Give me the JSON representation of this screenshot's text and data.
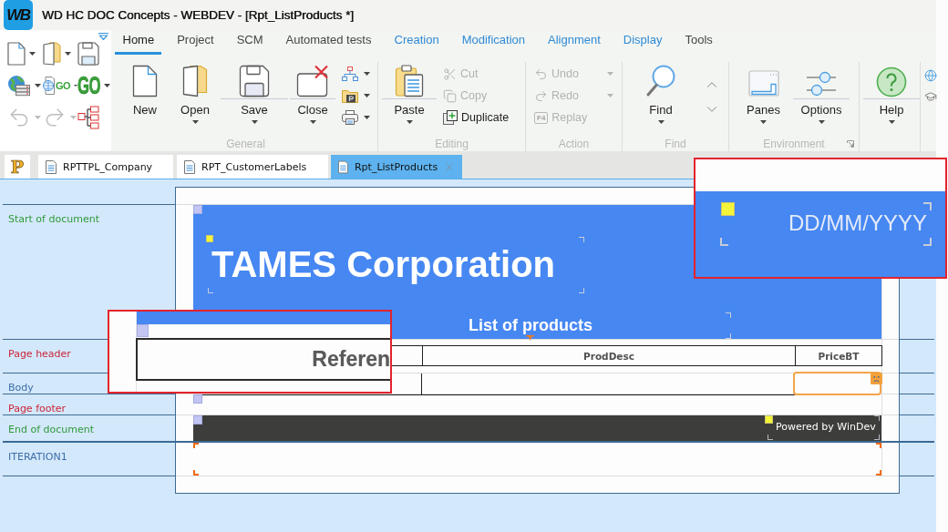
{
  "window": {
    "logo": "WB",
    "title": "WD HC DOC Concepts - WEBDEV - [Rpt_ListProducts *]"
  },
  "quick_access": {
    "go_buttons": [
      {
        "kind": "site",
        "label": "GO"
      },
      {
        "kind": "plain",
        "label": "GO"
      }
    ]
  },
  "ribbon_tabs": [
    {
      "label": "Home",
      "selected": true,
      "kind": "main"
    },
    {
      "label": "Project",
      "selected": false,
      "kind": "main"
    },
    {
      "label": "SCM",
      "selected": false,
      "kind": "main"
    },
    {
      "label": "Automated tests",
      "selected": false,
      "kind": "main"
    },
    {
      "label": "Creation",
      "selected": false,
      "kind": "context"
    },
    {
      "label": "Modification",
      "selected": false,
      "kind": "context"
    },
    {
      "label": "Alignment",
      "selected": false,
      "kind": "context"
    },
    {
      "label": "Display",
      "selected": false,
      "kind": "context"
    },
    {
      "label": "Tools",
      "selected": false,
      "kind": "main"
    }
  ],
  "ribbon_groups": [
    {
      "title": "General",
      "buttons": [
        {
          "kind": "large",
          "label": "New",
          "dropdown": false,
          "split": false
        },
        {
          "kind": "large",
          "label": "Open",
          "dropdown": true,
          "split": false
        },
        {
          "kind": "large",
          "label": "Save",
          "dropdown": true,
          "split": true
        },
        {
          "kind": "large",
          "label": "Close",
          "dropdown": true,
          "split": true
        },
        {
          "kind": "icon_stack"
        }
      ]
    },
    {
      "title": "Editing",
      "buttons": [
        {
          "kind": "large",
          "label": "Paste",
          "dropdown": true,
          "split": true
        },
        {
          "kind": "small_stack",
          "items": [
            {
              "label": "Cut",
              "disabled": true,
              "dropdown": false
            },
            {
              "label": "Copy",
              "disabled": true,
              "dropdown": false
            },
            {
              "label": "Duplicate",
              "disabled": false,
              "dropdown": false
            }
          ]
        }
      ]
    },
    {
      "title": "Action",
      "buttons": [
        {
          "kind": "small_stack",
          "items": [
            {
              "label": "Undo",
              "disabled": true,
              "dropdown": true
            },
            {
              "label": "Redo",
              "disabled": true,
              "dropdown": true
            },
            {
              "label": "Replay",
              "disabled": true,
              "dropdown": false,
              "shortcut": "F4"
            }
          ]
        }
      ]
    },
    {
      "title": "Find",
      "buttons": [
        {
          "kind": "large",
          "label": "Find",
          "dropdown": true,
          "split": false
        },
        {
          "kind": "nav_arrows"
        }
      ]
    },
    {
      "title": "Environment",
      "launcher": true,
      "buttons": [
        {
          "kind": "large",
          "label": "Panes",
          "dropdown": true,
          "split": false
        },
        {
          "kind": "large",
          "label": "Options",
          "dropdown": true,
          "split": true
        }
      ]
    },
    {
      "buttons": [
        {
          "kind": "large",
          "label": "Help",
          "dropdown": true,
          "split": true
        }
      ]
    }
  ],
  "document_tabs": {
    "project_tab": "P",
    "tabs": [
      {
        "label": "RPTTPL_Company",
        "selected": false
      },
      {
        "label": "RPT_CustomerLabels",
        "selected": false
      },
      {
        "label": "Rpt_ListProducts",
        "selected": true
      }
    ]
  },
  "sections": [
    {
      "kind": "banner",
      "label": "Start of document",
      "color": "#2f9a3c",
      "title": "TAMES Corporation",
      "subtitle": "List of products"
    },
    {
      "kind": "column_headers",
      "label": "Page header",
      "color": "#cc2438",
      "columns": [
        "ProdDesc",
        "PriceBT"
      ]
    },
    {
      "kind": "table_row",
      "label": "Body",
      "color": "#3b6ea8",
      "cells": [
        {
          "error": false
        },
        {
          "error": true
        }
      ]
    },
    {
      "kind": "blank",
      "label": "Page footer",
      "color": "#cc2438"
    },
    {
      "kind": "dark_band",
      "label": "End of document",
      "color": "#2f9a3c",
      "text": "Powered by WinDev"
    },
    {
      "kind": "frame",
      "label": "ITERATION1",
      "color": "#3b6ea8"
    }
  ],
  "lenses": [
    {
      "kind": "date",
      "text": "DD/MM/YYYY"
    },
    {
      "kind": "column_header",
      "text": "Referen"
    }
  ]
}
